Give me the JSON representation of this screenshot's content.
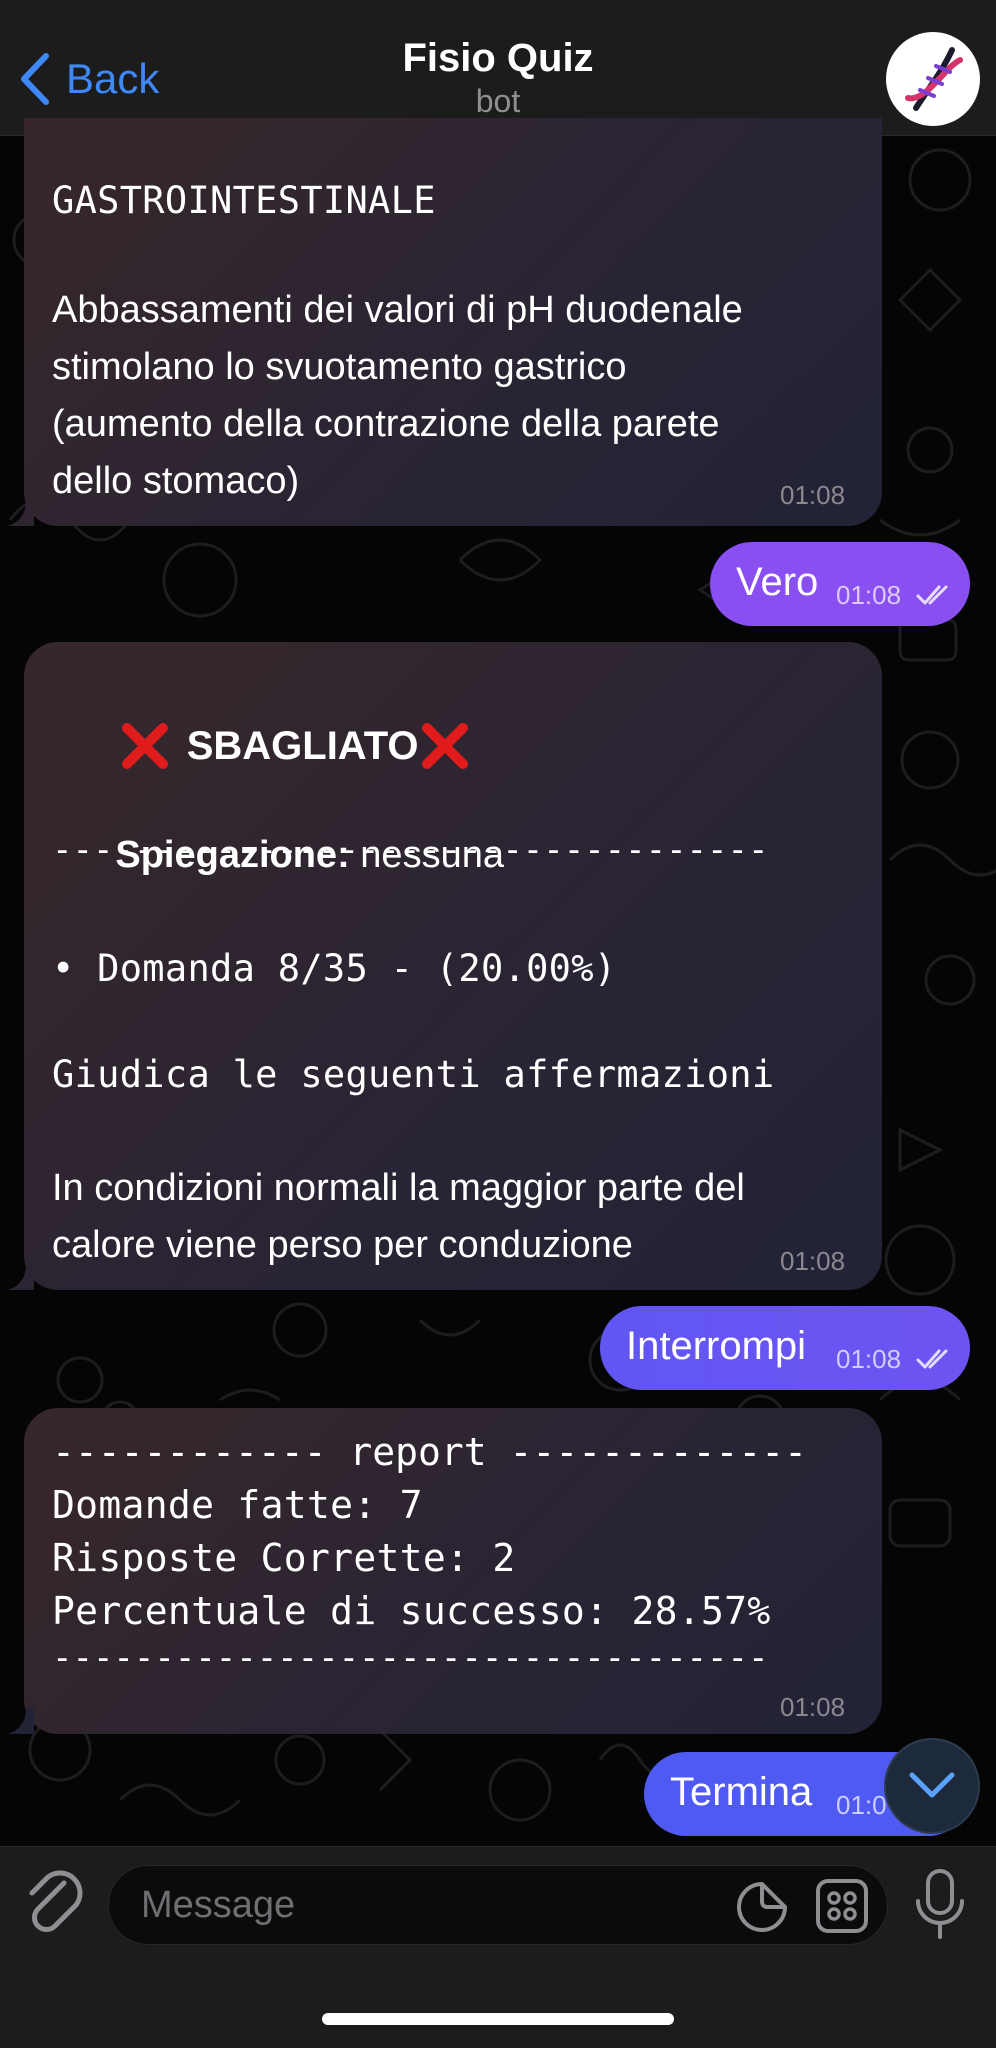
{
  "header": {
    "back_label": "Back",
    "title": "Fisio Quiz",
    "subtitle": "bot",
    "avatar_icon": "dna-icon"
  },
  "colors": {
    "accent": "#3e88f7",
    "bubble_out_purple": "#8a4ff0",
    "bubble_out_blue": "#4f5af2",
    "bubble_in": "#2b2433",
    "error_red": "#e01b1b"
  },
  "messages": {
    "m1": {
      "lines": [
        "GASTROINTESTINALE",
        "Abbassamenti dei valori di pH duodenale",
        "stimolano lo svuotamento gastrico",
        "(aumento della contrazione della parete",
        "dello stomaco)"
      ],
      "time": "01:08"
    },
    "m2": {
      "text": "Vero",
      "time": "01:08"
    },
    "m3": {
      "title": "SBAGLIATO",
      "expl_label": "Spiegazione:",
      "expl_value": "nessuna",
      "divider": "-----------------------------------",
      "question_index": "• Domanda 8/35 - (20.00%)",
      "instruction": "Giudica le seguenti affermazioni",
      "statement_1": "In condizioni normali la maggior parte del",
      "statement_2": "calore viene perso per conduzione",
      "time": "01:08"
    },
    "m4": {
      "text": "Interrompi",
      "time": "01:08"
    },
    "m5": {
      "header": "------------ report -------------",
      "line1": "Domande fatte: 7",
      "line2": "Risposte Corrette: 2",
      "line3": "Percentuale di successo: 28.57%",
      "footer": "-----------------------------------",
      "time": "01:08"
    },
    "m6": {
      "text": "Termina",
      "time": "01:0"
    }
  },
  "input": {
    "placeholder": "Message"
  },
  "icons": [
    "chevron-left-icon",
    "dna-icon",
    "attach-icon",
    "sticker-icon",
    "bot-commands-icon",
    "microphone-icon",
    "chevron-down-icon",
    "double-check-icon",
    "cross-mark-icon"
  ]
}
